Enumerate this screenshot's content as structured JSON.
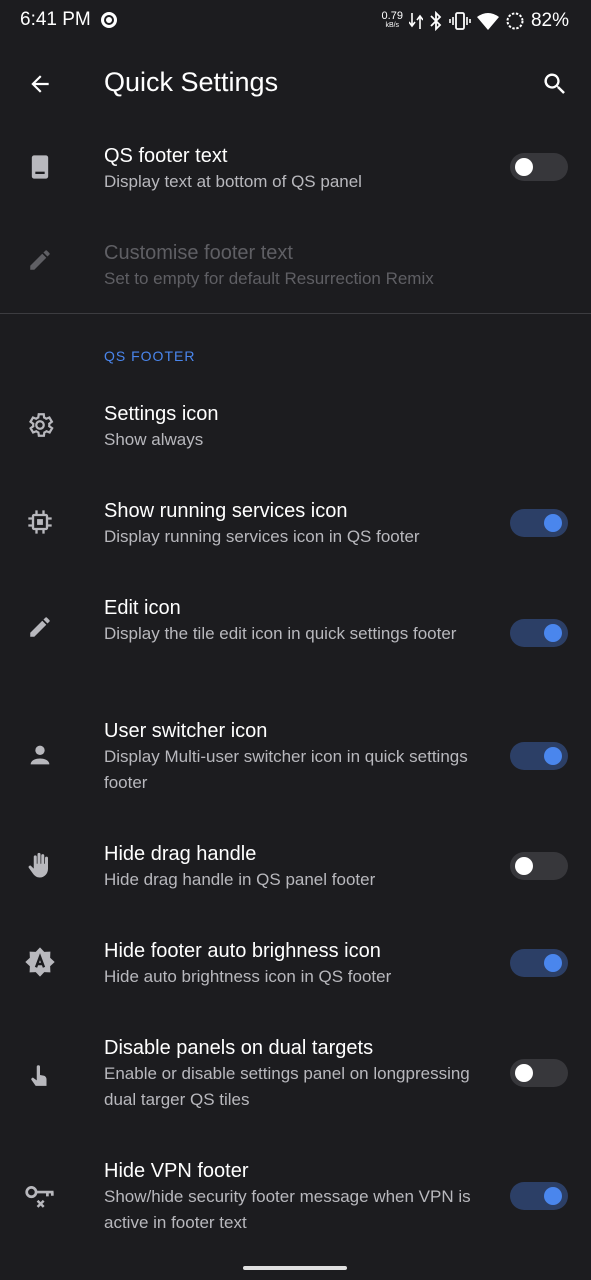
{
  "status_bar": {
    "time": "6:41 PM",
    "net_speed_value": "0.79",
    "net_speed_unit": "kB/s",
    "battery_percent": "82%",
    "icons": [
      "record-icon",
      "data-arrows-icon",
      "bluetooth-icon",
      "vibrate-icon",
      "wifi-icon",
      "battery-saver-icon"
    ]
  },
  "app_bar": {
    "title": "Quick Settings",
    "back_icon": "arrow-back-icon",
    "search_icon": "search-icon"
  },
  "top_settings": [
    {
      "title": "QS footer text",
      "summary": "Display text at bottom of QS panel",
      "icon": "tablet-icon",
      "toggle": "off",
      "enabled": true
    },
    {
      "title": "Customise footer text",
      "summary": "Set to empty for default Resurrection Remix",
      "icon": "pencil-icon",
      "enabled": false
    }
  ],
  "section": {
    "header": "QS FOOTER"
  },
  "footer_settings": [
    {
      "title": "Settings icon",
      "summary": "Show always",
      "icon": "gear-icon"
    },
    {
      "title": "Show running services icon",
      "summary": "Display running services icon in QS footer",
      "icon": "chip-icon",
      "toggle": "on"
    },
    {
      "title": "Edit icon",
      "summary": "Display the tile edit icon in quick settings footer",
      "icon": "pencil-icon",
      "toggle": "on"
    },
    {
      "title": "User switcher icon",
      "summary": "Display Multi-user switcher icon in quick settings footer",
      "icon": "person-icon",
      "toggle": "on"
    },
    {
      "title": "Hide drag handle",
      "summary": "Hide drag handle in QS panel footer",
      "icon": "hand-icon",
      "toggle": "off"
    },
    {
      "title": "Hide footer auto brighness icon",
      "summary": "Hide auto brightness icon in QS footer",
      "icon": "auto-brightness-icon",
      "toggle": "on"
    },
    {
      "title": "Disable panels on dual targets",
      "summary": "Enable or disable settings panel on longpressing dual targer QS tiles",
      "icon": "touch-icon",
      "toggle": "off"
    },
    {
      "title": "Hide VPN footer",
      "summary": "Show/hide security footer message when VPN is active in footer text",
      "icon": "vpn-key-off-icon",
      "toggle": "on"
    }
  ],
  "colors": {
    "background": "#1c1c1f",
    "accent": "#4a86ed",
    "toggle_on_track": "#2c3f66",
    "toggle_off_track": "#37373b"
  }
}
